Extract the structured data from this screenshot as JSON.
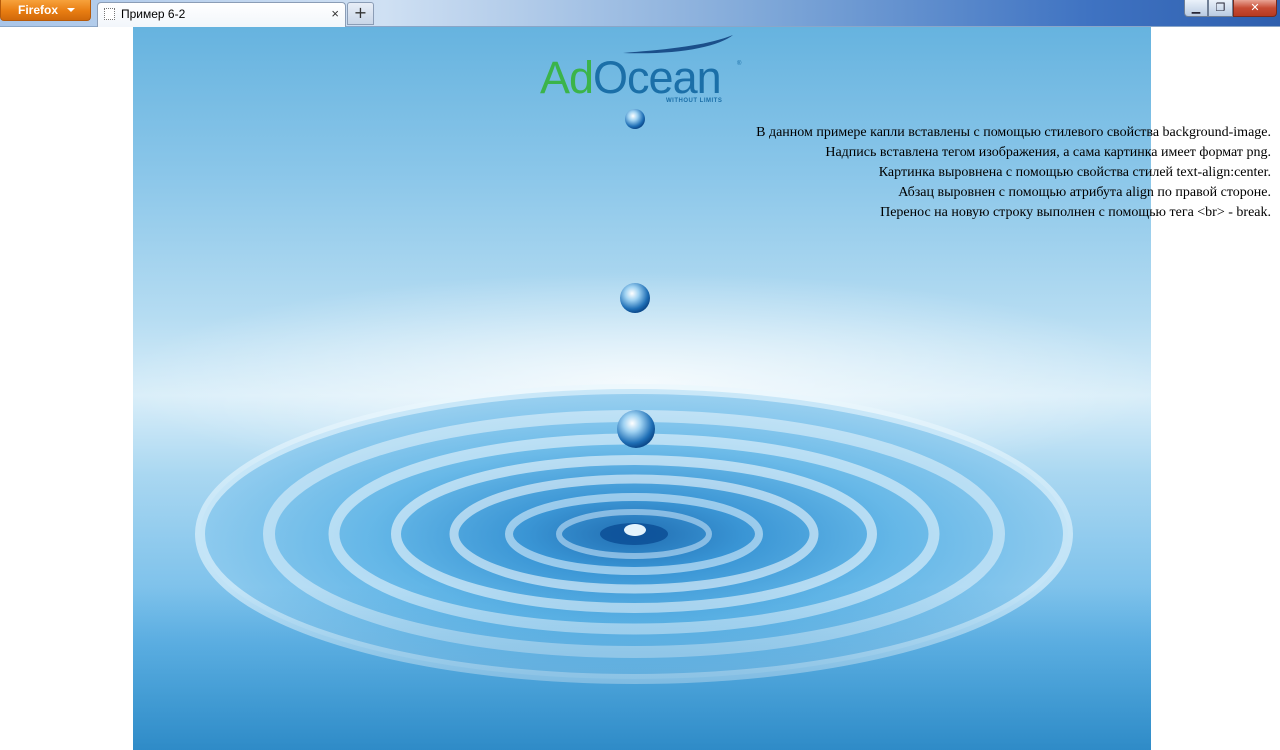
{
  "browser": {
    "app_button_label": "Firefox",
    "tab": {
      "title": "Пример 6-2",
      "close_glyph": "×"
    },
    "new_tab_glyph": "+",
    "window_controls": {
      "minimize_glyph": "▁",
      "maximize_glyph": "❐",
      "close_glyph": "✕"
    }
  },
  "page": {
    "logo": {
      "part1": "Ad",
      "part2": "Ocean",
      "registered": "®",
      "tagline": "WITHOUT LIMITS",
      "colors": {
        "ad": "#3bb44a",
        "ocean": "#1b6fa8"
      }
    },
    "paragraph_lines": [
      "В данном примере капли вставлены с помощью стилевого свойства background-image.",
      "Надпись вставлена тегом изображения, а сама картинка имеет формат png.",
      "Картинка выровнена с помощью свойства стилей text-align:center.",
      "Абзац выровнен с помощью атрибута align по правой стороне.",
      "Перенос на новую строку выполнен с помощью тега <br> - break."
    ],
    "background_colors": {
      "sky_top": "#66b3df",
      "horizon": "#d9eef9",
      "water": "#55addf"
    }
  }
}
